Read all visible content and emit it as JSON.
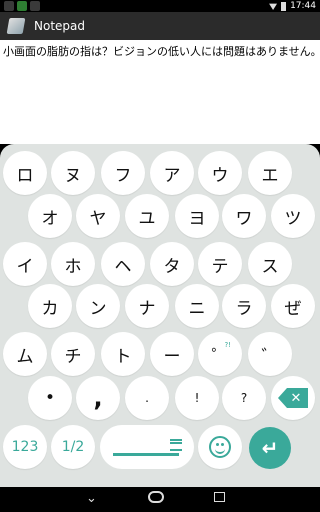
{
  "status_bar": {
    "time": "17:44",
    "wifi_icon": "wifi-icon",
    "battery_icon": "battery-icon"
  },
  "app": {
    "title": "Notepad",
    "icon": "notepad-icon"
  },
  "editor": {
    "text": "小画面の脂肪の指は？ビジョンの低い人には問題はありません。"
  },
  "keyboard": {
    "rows": [
      [
        "ロ",
        "ヌ",
        "フ",
        "ア",
        "ウ",
        "エ"
      ],
      [
        "オ",
        "ヤ",
        "ユ",
        "ヨ",
        "ワ",
        "ツ"
      ],
      [
        "イ",
        "ホ",
        "ヘ",
        "タ",
        "テ",
        "ス"
      ],
      [
        "カ",
        "ン",
        "ナ",
        "ニ",
        "ラ",
        "ぜ"
      ],
      [
        "ム",
        "チ",
        "ト",
        "ー",
        "゜",
        "゛"
      ]
    ],
    "small_row": [
      "•",
      ",",
      ".",
      "!",
      "?",
      "@"
    ],
    "sup_label": "?!",
    "num_label": "123",
    "page_label": "1/2",
    "backspace_icon": "backspace-icon",
    "emoji_icon": "emoji-icon",
    "enter_icon": "enter-icon",
    "enter_symbol": "↵",
    "backspace_symbol": "✕"
  },
  "nav_bar": {
    "back_symbol": "⌄",
    "home_icon": "home-icon",
    "recents_icon": "recents-icon"
  },
  "colors": {
    "accent": "#3aa99a",
    "keyboard_bg": "#dfe3e1",
    "app_bar": "#2b2b2b"
  }
}
